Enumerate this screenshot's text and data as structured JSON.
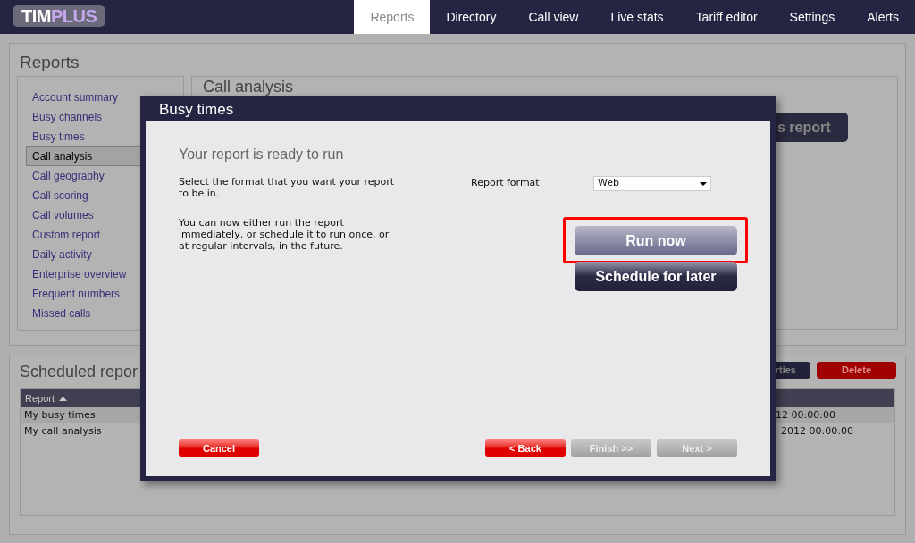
{
  "logo": [
    "TIM",
    "PLUS"
  ],
  "nav_tabs": [
    {
      "label": "Reports",
      "selected": true
    },
    {
      "label": "Directory",
      "selected": false
    },
    {
      "label": "Call view",
      "selected": false
    },
    {
      "label": "Live stats",
      "selected": false
    },
    {
      "label": "Tariff editor",
      "selected": false
    },
    {
      "label": "Settings",
      "selected": false
    },
    {
      "label": "Alerts",
      "selected": false
    }
  ],
  "reports_panel": {
    "title": "Reports",
    "report_list": [
      {
        "label": "Account summary",
        "selected": false
      },
      {
        "label": "Busy channels",
        "selected": false
      },
      {
        "label": "Busy times",
        "selected": false
      },
      {
        "label": "Call analysis",
        "selected": true
      },
      {
        "label": "Call geography",
        "selected": false
      },
      {
        "label": "Call scoring",
        "selected": false
      },
      {
        "label": "Call volumes",
        "selected": false
      },
      {
        "label": "Custom report",
        "selected": false
      },
      {
        "label": "Daily activity",
        "selected": false
      },
      {
        "label": "Enterprise overview",
        "selected": false
      },
      {
        "label": "Frequent numbers",
        "selected": false
      },
      {
        "label": "Missed calls",
        "selected": false
      }
    ],
    "detail_title": "Call analysis",
    "detail_button": "s report"
  },
  "scheduled_panel": {
    "title": "Scheduled repor",
    "buttons": [
      {
        "label": "rties",
        "kind": "dark"
      },
      {
        "label": "Delete",
        "kind": "danger"
      }
    ],
    "table": {
      "columns": [
        {
          "label": "Report",
          "sorted": true
        }
      ],
      "rows": [
        {
          "cells": [
            "My busy times",
            "12 00:00:00"
          ],
          "selected": true
        },
        {
          "cells": [
            "My call analysis",
            "2012 00:00:00"
          ],
          "selected": false
        }
      ]
    }
  },
  "dialog": {
    "title": "Busy times",
    "heading": "Your report is ready to run",
    "paragraphs": [
      "Select the format that you want your report to be in.",
      "You can now either run the report immediately, or schedule it to run once, or at regular intervals, in the future."
    ],
    "format_label": "Report format",
    "format_value": "Web",
    "actions": [
      {
        "label": "Run now",
        "highlighted": true
      },
      {
        "label": "Schedule for later",
        "highlighted": false
      }
    ],
    "footer_buttons": [
      {
        "label": "Cancel",
        "disabled": false
      },
      {
        "label": "< Back",
        "disabled": false
      },
      {
        "label": "Finish >>",
        "disabled": true
      },
      {
        "label": "Next >",
        "disabled": true
      }
    ]
  }
}
